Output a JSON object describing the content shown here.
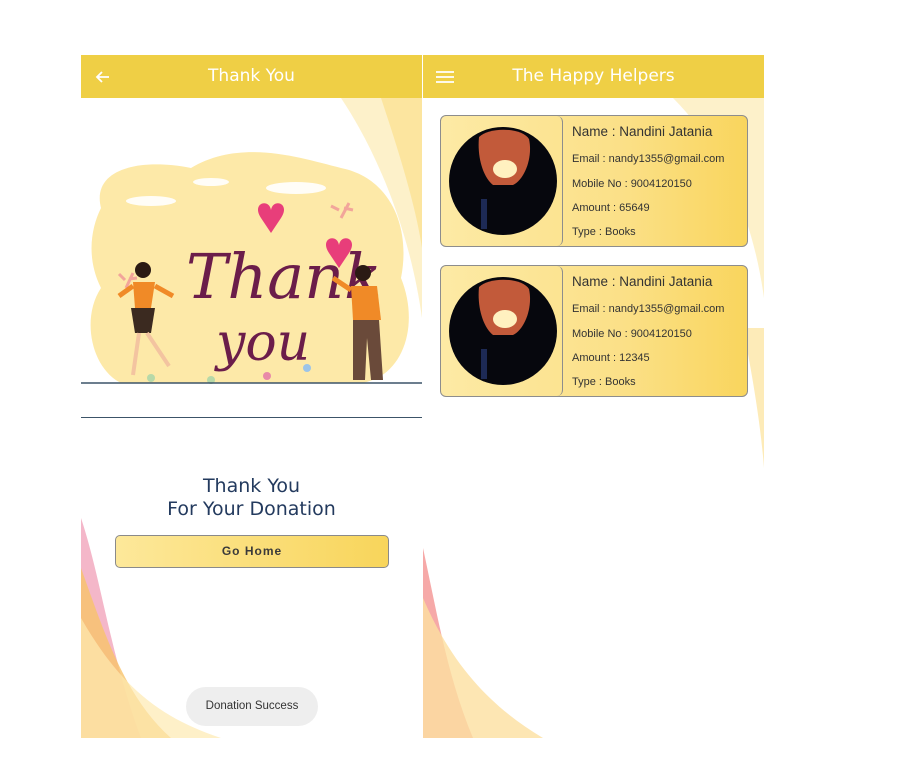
{
  "left_screen": {
    "appbar": {
      "title": "Thank You",
      "back_icon": "arrow-left-icon"
    },
    "illustration": {
      "word1": "Thank",
      "word2": "you"
    },
    "message": {
      "line1": "Thank You",
      "line2": "For Your Donation"
    },
    "go_home_label": "Go Home",
    "toast": "Donation Success"
  },
  "right_screen": {
    "appbar": {
      "title": "The Happy Helpers",
      "menu_icon": "hamburger-menu-icon"
    },
    "helpers": [
      {
        "name": "Name : Nandini Jatania",
        "email": "Email : nandy1355@gmail.com",
        "mobile": "Mobile No : 9004120150",
        "amount": "Amount : 65649",
        "type": "Type : Books"
      },
      {
        "name": "Name : Nandini Jatania",
        "email": "Email : nandy1355@gmail.com",
        "mobile": "Mobile No : 9004120150",
        "amount": "Amount : 12345",
        "type": "Type : Books"
      }
    ]
  },
  "colors": {
    "appbar": "#efcf45",
    "accent_yellow": "#f9d55d",
    "pink": "#e83e7a",
    "text_dark_blue": "#233a5e"
  }
}
